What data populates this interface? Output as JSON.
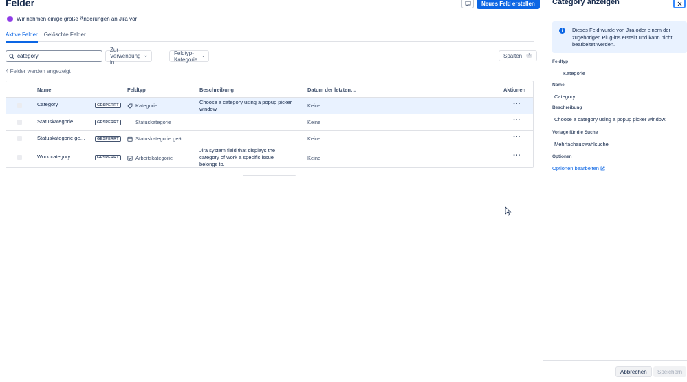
{
  "main": {
    "title": "Felder",
    "create_button": "Neues Feld erstellen",
    "banner": {
      "icon": "info-icon",
      "text": "Wir nehmen einige große Änderungen an Jira vor",
      "color": "#8f3ce7"
    },
    "tabs": [
      {
        "label": "Aktive Felder",
        "active": true
      },
      {
        "label": "Gelöschte Felder",
        "active": false
      }
    ],
    "search": {
      "value": "category",
      "icon": "search-icon"
    },
    "filters": {
      "usage": "Zur Verwendung in",
      "field_type": "Feldtyp-Kategorie"
    },
    "columns_button": {
      "label": "Spalten",
      "count": "3"
    },
    "result_count": "4 Felder werden angezeigt",
    "table": {
      "headers": [
        "Name",
        "Feldtyp",
        "Beschreibung",
        "Datum der letzten…",
        "Aktionen"
      ],
      "rows": [
        {
          "name": "Category",
          "locked": "GESPERRT",
          "type_icon": "tag-icon",
          "type": "Kategorie",
          "description": "Choose a category using a popup picker window.",
          "date": "Keine",
          "selected": true
        },
        {
          "name": "Statuskategorie",
          "locked": "GESPERRT",
          "type_icon": "",
          "type": "Statuskategorie",
          "description": "",
          "date": "Keine",
          "selected": false
        },
        {
          "name": "Statuskategorie ge…",
          "locked": "GESPERRT",
          "type_icon": "calendar-icon",
          "type": "Statuskategorie geä…",
          "description": "",
          "date": "Keine",
          "selected": false
        },
        {
          "name": "Work category",
          "locked": "GESPERRT",
          "type_icon": "checkbox-icon",
          "type": "Arbeitskategorie",
          "description": "Jira system field that displays the category of work a specific issue belongs to.",
          "date": "Keine",
          "selected": false
        }
      ],
      "more_label": "···"
    }
  },
  "panel": {
    "title": "Category anzeigen",
    "info_text": "Dieses Feld wurde von Jira oder einem der zugehörigen Plug-ins erstellt und kann nicht bearbeitet werden.",
    "field_type_label": "Feldtyp",
    "field_type_value": "Kategorie",
    "name_label": "Name",
    "name_value": "Category",
    "description_label": "Beschreibung",
    "description_value": "Choose a category using a popup picker window.",
    "search_template_label": "Vorlage für die Suche",
    "search_template_value": "Mehrfachauswahlsuche",
    "options_label": "Optionen",
    "options_link": "Optionen bearbeiten",
    "cancel_button": "Abbrechen",
    "save_button": "Speichern"
  },
  "colors": {
    "primary": "#0c66e4",
    "selected_row": "#e9f2ff",
    "text": "#172b4d"
  }
}
